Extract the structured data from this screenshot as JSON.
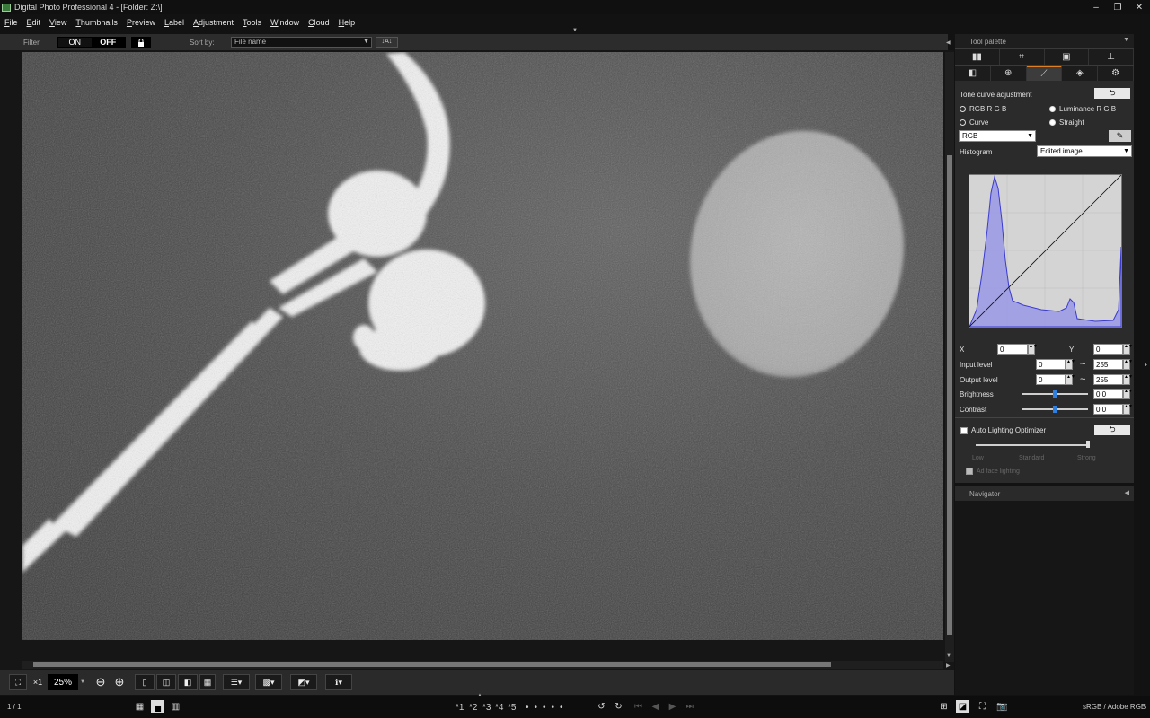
{
  "window": {
    "title": "Digital Photo Professional 4 - [Folder: Z:\\]",
    "minimize": "–",
    "maximize": "❐",
    "close": "✕"
  },
  "menu": [
    "File",
    "Edit",
    "View",
    "Thumbnails",
    "Preview",
    "Label",
    "Adjustment",
    "Tools",
    "Window",
    "Cloud",
    "Help"
  ],
  "filterbar": {
    "filter_label": "Filter",
    "on_label": "ON",
    "off_label": "OFF",
    "sort_label": "Sort by:",
    "sort_value": "File name",
    "sort_dir": "↓A↓"
  },
  "toolbar": {
    "fit_icon": "fit-window-icon",
    "x1_label": "×1",
    "zoom_value": "25%",
    "minus": "⊖",
    "plus": "⊕"
  },
  "status": {
    "page": "1 / 1",
    "ratings": [
      "*1",
      "*2",
      "*3",
      "*4",
      "*5"
    ],
    "color_space": "sRGB / Adobe RGB"
  },
  "panel": {
    "header": "Tool palette",
    "tab_icons_row1": [
      "film-icon",
      "crop-icon",
      "dust-icon",
      "stamp-icon"
    ],
    "tab_icons_row2": [
      "basic-icon",
      "zoom-icon",
      "tone-curve-icon",
      "color-icon",
      "gear-icon"
    ],
    "title": "Tone curve adjustment",
    "reset_glyph": "⮌",
    "radio_rgb": "RGB R G B",
    "radio_lum": "Luminance R G B",
    "radio_curve": "Curve",
    "radio_straight": "Straight",
    "channel_select": "RGB",
    "histogram_label": "Histogram",
    "histogram_select": "Edited image",
    "x_label": "X",
    "x_value": "0",
    "y_label": "Y",
    "y_value": "0",
    "input_label": "Input level",
    "input_from": "0",
    "input_to": "255",
    "output_label": "Output level",
    "output_from": "0",
    "output_to": "255",
    "tilde": "~",
    "brightness_label": "Brightness",
    "brightness_value": "0.0",
    "brightness_level": 0.5,
    "contrast_label": "Contrast",
    "contrast_value": "0.0",
    "contrast_level": 0.5,
    "alo_label": "Auto Lighting Optimizer",
    "alo_low": "Low",
    "alo_std": "Standard",
    "alo_strong": "Strong",
    "alo_level": 1.0,
    "face_label": "Ad face lighting"
  },
  "navigator": {
    "header": "Navigator"
  },
  "colors": {
    "accent_tab": "#e08020",
    "slider_knob": "#2f7fe0",
    "histogram_fill": "#6060d8"
  }
}
